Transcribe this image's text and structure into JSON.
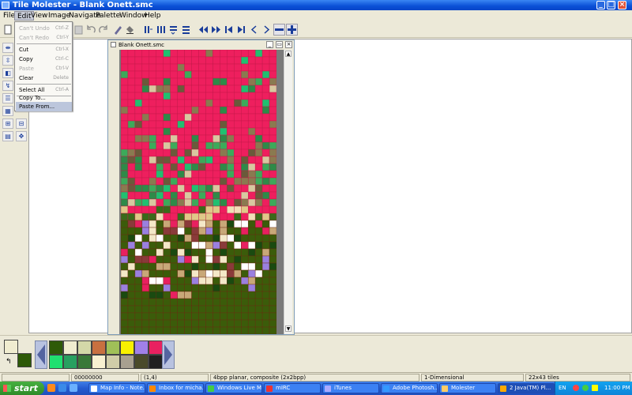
{
  "window": {
    "title": "Tile Molester - Blank Onett.smc"
  },
  "menubar": {
    "items": [
      "File",
      "Edit",
      "View",
      "Image",
      "Navigate",
      "Palette",
      "Window",
      "Help"
    ],
    "active": "Edit"
  },
  "edit_menu": {
    "items": [
      {
        "label": "Can't Undo",
        "shortcut": "Ctrl-Z",
        "enabled": false
      },
      {
        "label": "Can't Redo",
        "shortcut": "Ctrl-Y",
        "enabled": false
      },
      {
        "label": "Cut",
        "shortcut": "Ctrl-X",
        "enabled": true
      },
      {
        "label": "Copy",
        "shortcut": "Ctrl-C",
        "enabled": true
      },
      {
        "label": "Paste",
        "shortcut": "Ctrl-V",
        "enabled": false
      },
      {
        "label": "Clear",
        "shortcut": "Delete",
        "enabled": true
      },
      {
        "label": "Select All",
        "shortcut": "Ctrl-A",
        "enabled": true
      },
      {
        "label": "Copy To...",
        "shortcut": "",
        "enabled": true
      },
      {
        "label": "Paste From...",
        "shortcut": "",
        "enabled": true,
        "highlighted": true
      }
    ]
  },
  "document": {
    "title": "Blank Onett.smc"
  },
  "status": {
    "offset": "00000000",
    "coords": "(1,4)",
    "codec": "4bpp planar, composite (2x2bpp)",
    "mode": "1-Dimensional",
    "size": "22x43 tiles"
  },
  "palette": {
    "foreground": "#f0ecd0",
    "background": "#2e5a08",
    "row1": [
      "#2e5a08",
      "#f0ecd0",
      "#d4d8a8",
      "#c87040",
      "#a0c058",
      "#f8f000",
      "#a080e8",
      "#e82060"
    ],
    "row2": [
      "#20e070",
      "#28a060",
      "#3a7838",
      "#f8f0d0",
      "#d0cca8",
      "#a8a090",
      "#4a4a2a",
      "#202020"
    ]
  },
  "taskbar": {
    "start_label": "start",
    "tasks": [
      "Map Info - Note...",
      "Inbox for micha...",
      "Windows Live M...",
      "mIRC",
      "iTunes",
      "Adobe Photosh...",
      "Molester",
      "2 Java(TM) Pl..."
    ],
    "active_task": "2 Java(TM) Pl...",
    "language": "EN",
    "clock": "11:00 PM"
  }
}
